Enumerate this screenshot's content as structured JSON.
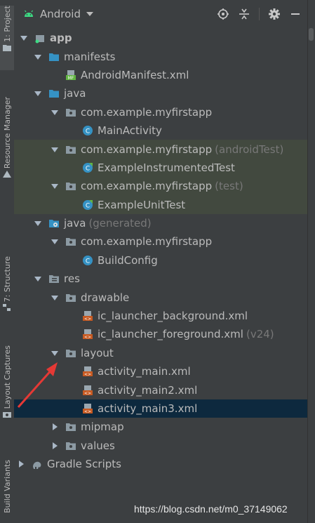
{
  "sidebar": {
    "tabs": [
      {
        "label": "1: Project",
        "icon": "folder-icon"
      },
      {
        "label": "Resource Manager",
        "icon": "resource-manager-icon"
      },
      {
        "label": "7: Structure",
        "icon": "structure-icon"
      },
      {
        "label": "Layout Captures",
        "icon": "camera-icon"
      },
      {
        "label": "Build Variants",
        "icon": "build-variants-icon"
      }
    ]
  },
  "toolbar": {
    "view_label": "Android",
    "icons": [
      "locate-icon",
      "collapse-all-icon",
      "gear-icon",
      "minimize-icon"
    ]
  },
  "tree": [
    {
      "label": "app",
      "suffix": "",
      "icon": "module-icon",
      "expanded": true
    },
    {
      "label": "manifests",
      "suffix": "",
      "icon": "folder-icon",
      "expanded": true
    },
    {
      "label": "AndroidManifest.xml",
      "suffix": "",
      "icon": "manifest-file-icon"
    },
    {
      "label": "java",
      "suffix": "",
      "icon": "folder-icon",
      "expanded": true
    },
    {
      "label": "com.example.myfirstapp",
      "suffix": "",
      "icon": "package-icon",
      "expanded": true
    },
    {
      "label": "MainActivity",
      "suffix": "",
      "icon": "class-icon"
    },
    {
      "label": "com.example.myfirstapp",
      "suffix": "(androidTest)",
      "icon": "package-icon",
      "expanded": true
    },
    {
      "label": "ExampleInstrumentedTest",
      "suffix": "",
      "icon": "test-class-icon"
    },
    {
      "label": "com.example.myfirstapp",
      "suffix": "(test)",
      "icon": "package-icon",
      "expanded": true
    },
    {
      "label": "ExampleUnitTest",
      "suffix": "",
      "icon": "test-class-icon"
    },
    {
      "label": "java",
      "suffix": "(generated)",
      "icon": "generated-folder-icon",
      "expanded": true
    },
    {
      "label": "com.example.myfirstapp",
      "suffix": "",
      "icon": "package-icon",
      "expanded": true
    },
    {
      "label": "BuildConfig",
      "suffix": "",
      "icon": "class-icon"
    },
    {
      "label": "res",
      "suffix": "",
      "icon": "res-folder-icon",
      "expanded": true
    },
    {
      "label": "drawable",
      "suffix": "",
      "icon": "package-icon",
      "expanded": true
    },
    {
      "label": "ic_launcher_background.xml",
      "suffix": "",
      "icon": "xml-file-icon"
    },
    {
      "label": "ic_launcher_foreground.xml",
      "suffix": "(v24)",
      "icon": "xml-file-icon"
    },
    {
      "label": "layout",
      "suffix": "",
      "icon": "package-icon",
      "expanded": true
    },
    {
      "label": "activity_main.xml",
      "suffix": "",
      "icon": "xml-file-icon"
    },
    {
      "label": "activity_main2.xml",
      "suffix": "",
      "icon": "xml-file-icon"
    },
    {
      "label": "activity_main3.xml",
      "suffix": "",
      "icon": "xml-file-icon",
      "selected": true
    },
    {
      "label": "mipmap",
      "suffix": "",
      "icon": "package-icon",
      "expanded": false
    },
    {
      "label": "values",
      "suffix": "",
      "icon": "package-icon",
      "expanded": false
    },
    {
      "label": "Gradle Scripts",
      "suffix": "",
      "icon": "gradle-icon",
      "expanded": false
    }
  ],
  "watermark": "https://blog.csdn.net/m0_37149062",
  "colors": {
    "selected_row": "#0d293e",
    "test_row": "#42493f",
    "annotation_arrow": "#e53935"
  }
}
